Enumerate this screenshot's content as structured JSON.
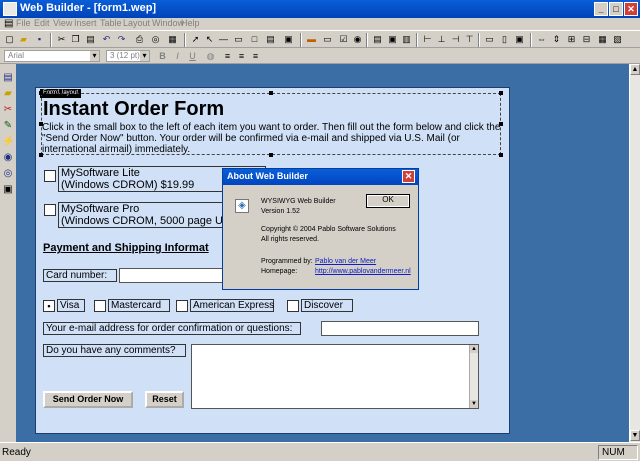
{
  "window": {
    "title": "Web Builder - [form1.wep]"
  },
  "menu": [
    "File",
    "Edit",
    "View",
    "Insert",
    "Table",
    "Layout",
    "Window",
    "Help"
  ],
  "toolbar": {
    "font_value": "Arial",
    "size_value": "3 (12 pt)"
  },
  "form": {
    "layout_tag": "Form1 layout",
    "title": "Instant Order Form",
    "intro": "Click in the small box to the left of each item you want to order. Then fill out the form below and click the \"Send Order Now\" button. Your order will be confirmed via e-mail and shipped via U.S. Mail (or international airmail) immediately.",
    "products": [
      {
        "name": "MySoftware Lite",
        "desc": "(Windows CDROM) $19.99"
      },
      {
        "name": "MySoftware Pro",
        "desc": "(Windows CDROM, 5000 page User M"
      }
    ],
    "payment_heading": "Payment and Shipping Informat",
    "card_label": "Card number:",
    "cards": [
      "Visa",
      "Mastercard",
      "American Express",
      "Discover"
    ],
    "email_label": "Your e-mail address for order confirmation or questions:",
    "comments_label": "Do you have any comments?",
    "send_button": "Send Order Now",
    "reset_button": "Reset"
  },
  "dialog": {
    "title": "About Web Builder",
    "product": "WYSIWYG Web Builder",
    "version": "Version 1.52",
    "copyright": "Copyright © 2004 Pablo Software Solutions",
    "rights": "All rights reserved.",
    "programmed_label": "Programmed by:",
    "programmed_value": "Pablo van der Meer",
    "homepage_label": "Homepage:",
    "homepage_value": "http://www.pablovandermeer.nl",
    "ok_label": "OK"
  },
  "status": {
    "text": "Ready",
    "num": "NUM"
  }
}
